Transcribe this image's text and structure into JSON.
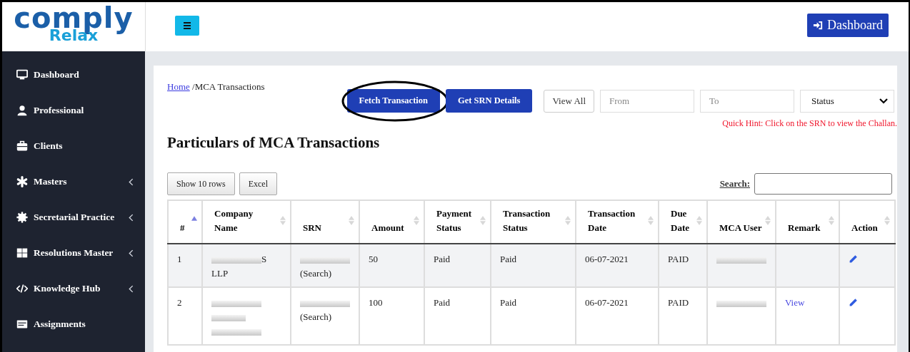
{
  "logo": {
    "word": "comply",
    "sub": "Relax"
  },
  "header": {
    "dashboard_button": "Dashboard"
  },
  "sidebar": {
    "items": [
      {
        "label": "Dashboard",
        "has_submenu": false
      },
      {
        "label": "Professional",
        "has_submenu": false
      },
      {
        "label": "Clients",
        "has_submenu": false
      },
      {
        "label": "Masters",
        "has_submenu": true
      },
      {
        "label": "Secretarial Practice",
        "has_submenu": true
      },
      {
        "label": "Resolutions Master",
        "has_submenu": true
      },
      {
        "label": "Knowledge Hub",
        "has_submenu": true
      },
      {
        "label": "Assignments",
        "has_submenu": false
      }
    ]
  },
  "breadcrumb": {
    "link": "Home",
    "current": "/MCA Transactions"
  },
  "toolbar": {
    "buttons": [
      {
        "label": "Fetch Transaction",
        "kind": "primary",
        "circled": true
      },
      {
        "label": "Get SRN Details",
        "kind": "primary",
        "circled": false
      },
      {
        "label": "View All",
        "kind": "default",
        "circled": false
      }
    ],
    "from": {
      "placeholder": "From"
    },
    "to": {
      "placeholder": "To"
    },
    "status_select": {
      "value": "Status"
    },
    "hint": "Quick Hint: Click on the SRN to view the Challan."
  },
  "heading": "Particulars of MCA Transactions",
  "table_buttons": [
    "Show 10 rows",
    "Excel"
  ],
  "search": {
    "label": "Search:"
  },
  "table": {
    "columns": [
      {
        "label": "#",
        "sorted": true
      },
      {
        "label": "Company Name",
        "sorted": false
      },
      {
        "label": "SRN",
        "sorted": false
      },
      {
        "label": "Amount",
        "sorted": false
      },
      {
        "label": "Payment Status",
        "sorted": false
      },
      {
        "label": "Transaction Status",
        "sorted": false
      },
      {
        "label": "Transaction Date",
        "sorted": false
      },
      {
        "label": "Due Date",
        "sorted": false
      },
      {
        "label": "MCA User",
        "sorted": false
      },
      {
        "label": "Remark",
        "sorted": false
      },
      {
        "label": "Action",
        "sorted": false
      }
    ],
    "rows": [
      {
        "number": "1",
        "company": [
          {
            "redacted": true,
            "text": "S"
          },
          {
            "redacted": false,
            "text": "LLP"
          }
        ],
        "srn": {
          "redacted": true,
          "link": "(Search)"
        },
        "amount": "50",
        "payment_status": "Paid",
        "transaction_status": "Paid",
        "transaction_date": "06-07-2021",
        "due_date": "PAID",
        "mca_user": {
          "redacted": true
        }
      },
      {
        "number": "2",
        "company": [
          {
            "redacted": true
          },
          {
            "redacted": true
          },
          {
            "redacted": true
          }
        ],
        "srn": {
          "redacted": true,
          "link": "(Search)"
        },
        "amount": "100",
        "payment_status": "Paid",
        "transaction_status": "Paid",
        "transaction_date": "06-07-2021",
        "due_date": "PAID",
        "mca_user": {
          "redacted": true
        },
        "remark": "View"
      }
    ]
  }
}
